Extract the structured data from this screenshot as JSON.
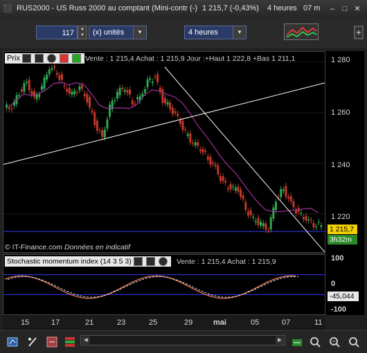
{
  "window": {
    "title": "RUS2000 - US Russ 2000 au comptant (Mini-contr (-)",
    "price": "1 215,7 (-0,43%)",
    "timeframe": "4 heures",
    "time": "07 m"
  },
  "toolbar": {
    "quantity": "117",
    "units": "(x) unités",
    "period": "4 heures"
  },
  "main_panel": {
    "name": "Prix",
    "info": "Vente : 1 215,4 Achat : 1 215,9 Jour :+Haut 1 222,8 +Bas 1 211,1",
    "watermark": "© IT-Finance.com",
    "watermark_note": "Données en indicatif",
    "price_tag": "1 215,7",
    "time_tag": "3h32m",
    "y_ticks": [
      "1 280",
      "1 260",
      "1 240",
      "1 220"
    ]
  },
  "stoch_panel": {
    "name": "Stochastic momentum index (14 3 5 3)",
    "info": "Vente : 1 215,4 Achat : 1 215,9",
    "value_tag": "-45,044",
    "y_ticks": [
      "100",
      "0",
      "-100"
    ]
  },
  "x_ticks": [
    "15",
    "17",
    "21",
    "23",
    "25",
    "29",
    "mai",
    "05",
    "07",
    "11"
  ],
  "colors": {
    "bull": "#2fa84f",
    "bear": "#c0392b",
    "ma": "#a0309a",
    "hline": "#3a3aff",
    "accent": "#2b3b68"
  },
  "icons": {
    "wrench": "wrench-icon",
    "window": "window-icon",
    "close": "close-icon",
    "sell": "sell-icon",
    "buy": "buy-icon",
    "chart_type": "chart-type-icon"
  },
  "chart_data": {
    "type": "line",
    "title": "RUS2000",
    "series": [
      {
        "name": "Prix",
        "values": [
          1262,
          1268,
          1272,
          1265,
          1270,
          1278,
          1276,
          1270,
          1267,
          1270,
          1265,
          1256,
          1250,
          1262,
          1268,
          1270,
          1264,
          1266,
          1272,
          1274,
          1265,
          1262,
          1258,
          1252,
          1248,
          1246,
          1242,
          1238,
          1232,
          1230,
          1230,
          1222,
          1218,
          1216,
          1214,
          1226,
          1230,
          1224,
          1220,
          1218,
          1216,
          1215.7
        ]
      }
    ],
    "ylim": [
      1205,
      1284
    ],
    "stochastic": {
      "name": "Stochastic momentum index (14 3 5 3)",
      "ylim": [
        -100,
        100
      ],
      "last": -45.044
    }
  }
}
